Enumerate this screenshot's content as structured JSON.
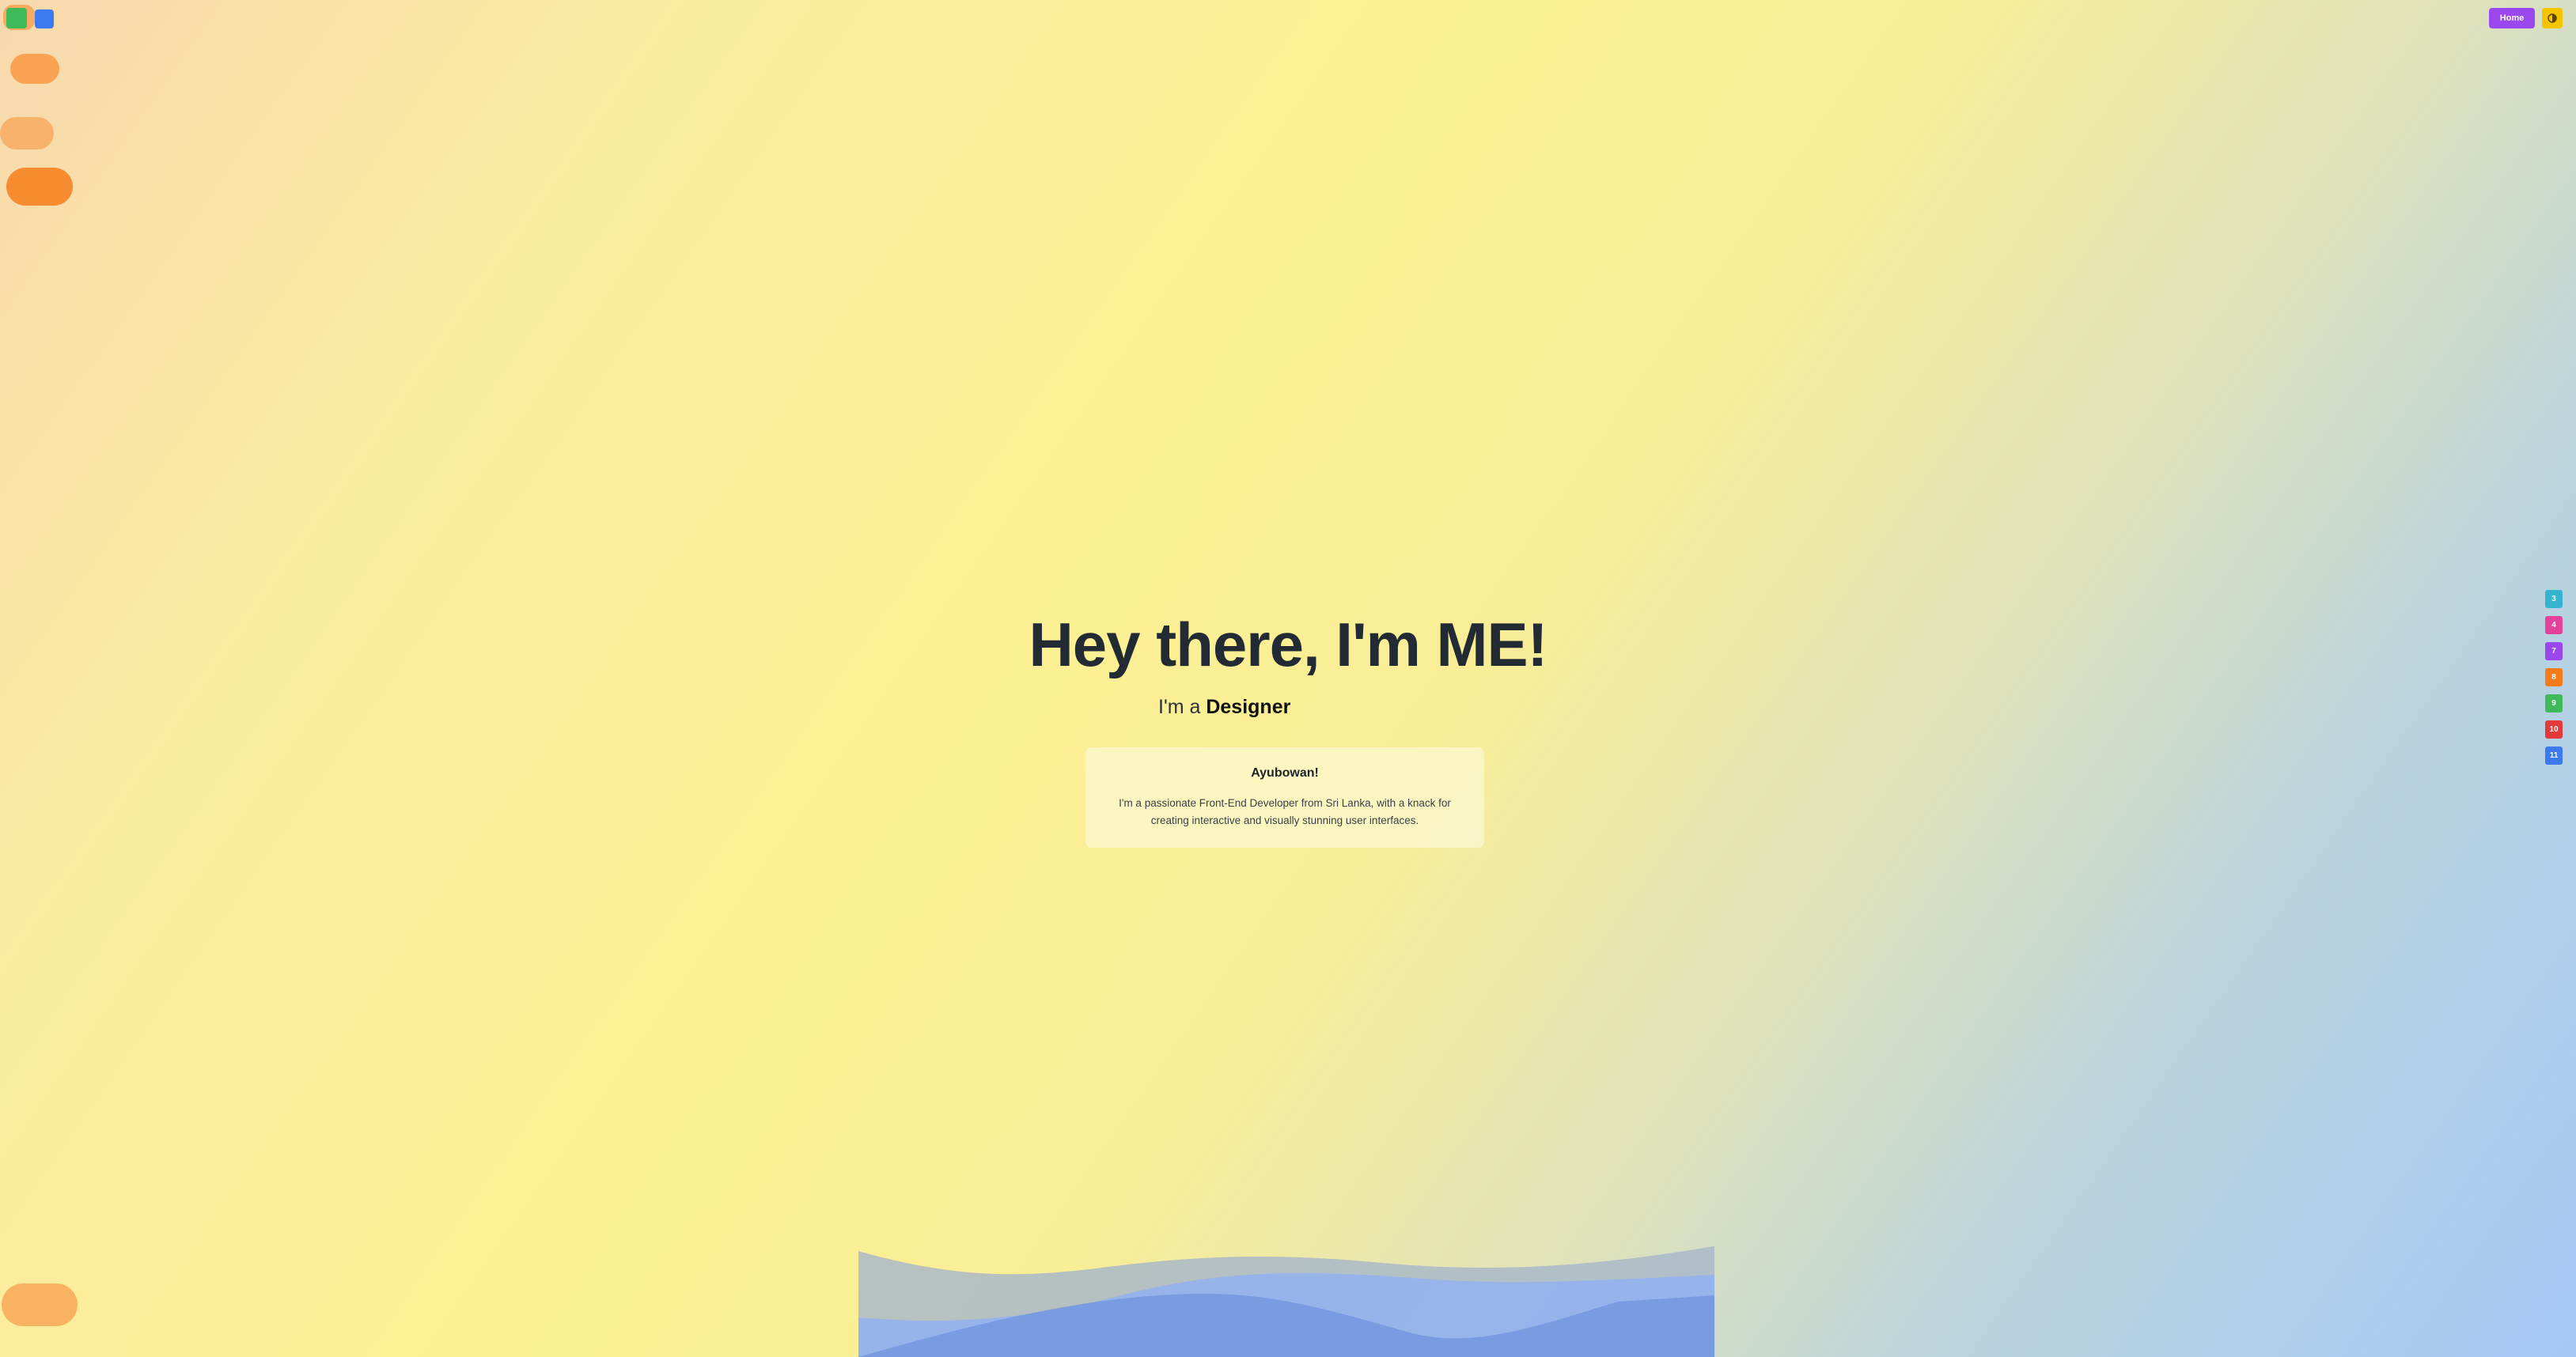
{
  "header": {
    "home_label": "Home",
    "theme_toggle_icon": "theme-toggle-icon"
  },
  "side_nav": {
    "items": [
      {
        "label": "3",
        "color": "#35b4cf"
      },
      {
        "label": "4",
        "color": "#e2429a"
      },
      {
        "label": "7",
        "color": "#9b47ee"
      },
      {
        "label": "8",
        "color": "#f57a1a"
      },
      {
        "label": "9",
        "color": "#3fba5a"
      },
      {
        "label": "10",
        "color": "#e23a3a"
      },
      {
        "label": "11",
        "color": "#3c7af0"
      }
    ]
  },
  "hero": {
    "title": "Hey there, I'm ME!",
    "subtitle_prefix": "I'm a ",
    "subtitle_role": "Designer"
  },
  "intro": {
    "heading": "Ayubowan!",
    "text": "I'm a passionate Front-End Developer from Sri Lanka, with a knack for creating interactive and visually stunning user interfaces."
  },
  "colors": {
    "accent": "#9b47ee",
    "toggle": "#f5c300",
    "wave_back": "#a9b9c8",
    "wave_mid": "#93b2ee",
    "wave_front": "#6f93de"
  }
}
